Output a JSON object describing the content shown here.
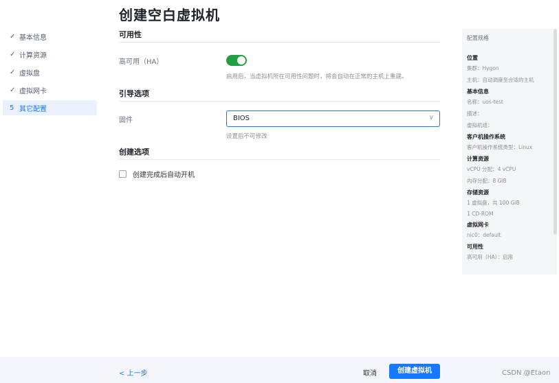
{
  "page": {
    "title": "创建空白虚拟机"
  },
  "steps": [
    {
      "mark": "✓",
      "label": "基本信息"
    },
    {
      "mark": "✓",
      "label": "计算资源"
    },
    {
      "mark": "✓",
      "label": "虚拟盘"
    },
    {
      "mark": "✓",
      "label": "虚拟网卡"
    },
    {
      "mark": "5",
      "label": "其它配置"
    }
  ],
  "availability": {
    "title": "可用性",
    "ha_label": "高可用（HA）",
    "ha_enabled": true,
    "ha_hint": "启用后，当虚拟机所在可用性问题时，将会自动在正常的主机上重建。"
  },
  "boot": {
    "title": "引导选项",
    "firmware_label": "固件",
    "firmware_value": "BIOS",
    "firmware_hint": "设置后不可修改"
  },
  "create": {
    "title": "创建选项",
    "autostart_label": "创建完成后自动开机",
    "autostart_checked": false
  },
  "spec": {
    "title": "配置规格",
    "sections": [
      {
        "heading": "位置",
        "lines": [
          "集群：Hygon",
          "主机：自动调度至合适的主机"
        ]
      },
      {
        "heading": "基本信息",
        "lines": [
          "名称：uos-test",
          "描述：",
          "虚拟机组："
        ]
      },
      {
        "heading": "客户机操作系统",
        "lines": [
          "客户机操作系统类型：Linux"
        ]
      },
      {
        "heading": "计算资源",
        "lines": [
          "vCPU 分配：4 vCPU",
          "内存分配：8 GiB"
        ]
      },
      {
        "heading": "存储资源",
        "lines": [
          "1 虚拟盘，共 100 GiB",
          "1 CD-ROM"
        ]
      },
      {
        "heading": "虚拟网卡",
        "lines": [
          "nic0：default"
        ]
      },
      {
        "heading": "可用性",
        "lines": [
          "高可用（HA）：启用"
        ]
      }
    ]
  },
  "footer": {
    "prev_label": "< 上一步",
    "cancel_label": "取消",
    "submit_label": "创建虚拟机",
    "watermark": "CSDN @Etaon"
  },
  "colors": {
    "accent": "#1677ff",
    "toggle_on": "#22a045"
  }
}
